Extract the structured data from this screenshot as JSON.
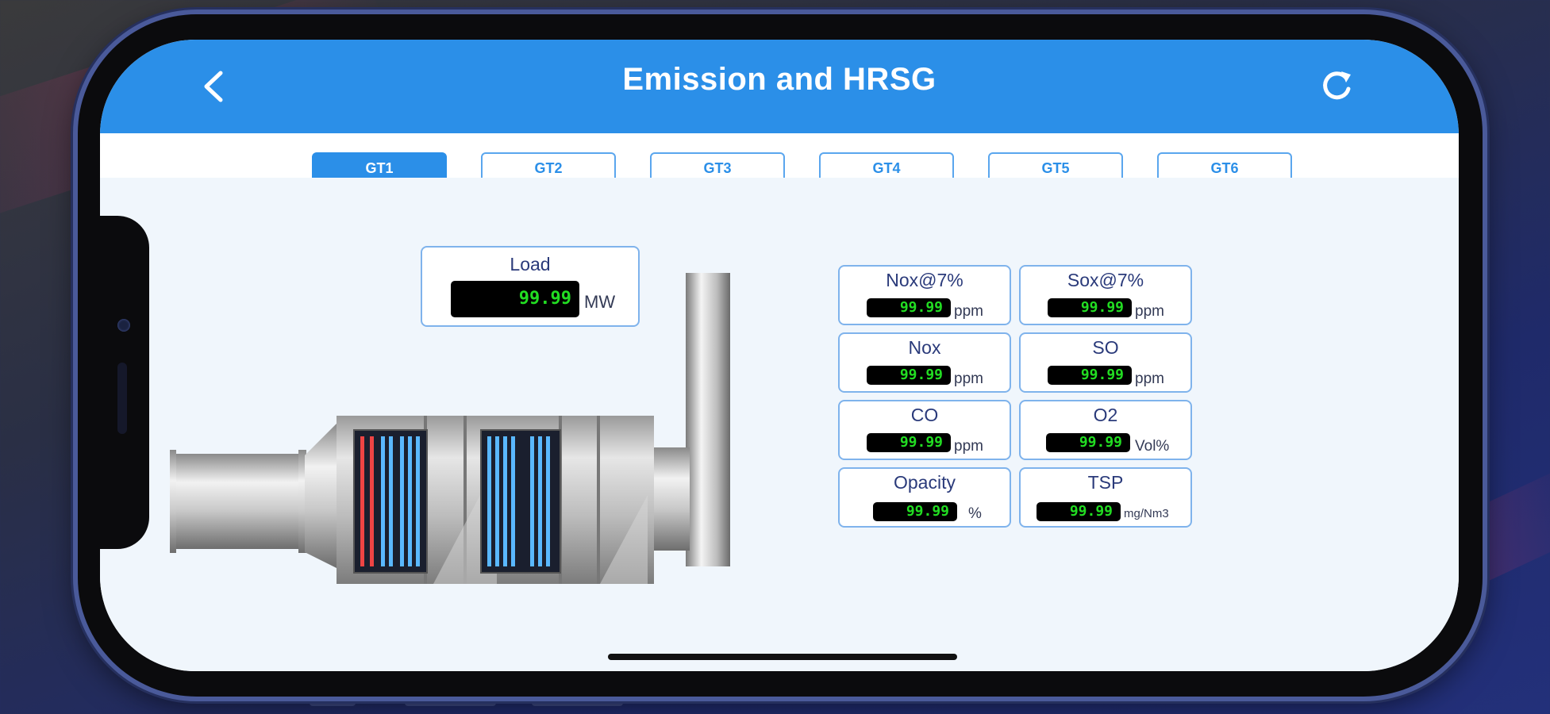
{
  "header": {
    "title": "Emission and HRSG",
    "back_icon": "chevron-left-icon",
    "refresh_icon": "refresh-icon",
    "color": "#2b8fe8"
  },
  "tabs": [
    {
      "label": "GT1",
      "active": true
    },
    {
      "label": "GT2",
      "active": false
    },
    {
      "label": "GT3",
      "active": false
    },
    {
      "label": "GT4",
      "active": false
    },
    {
      "label": "GT5",
      "active": false
    },
    {
      "label": "GT6",
      "active": false
    }
  ],
  "load": {
    "label": "Load",
    "value": "99.99",
    "unit": "MW"
  },
  "metrics": [
    {
      "label": "Nox@7%",
      "value": "99.99",
      "unit": "ppm"
    },
    {
      "label": "Sox@7%",
      "value": "99.99",
      "unit": "ppm"
    },
    {
      "label": "Nox",
      "value": "99.99",
      "unit": "ppm"
    },
    {
      "label": "SO",
      "value": "99.99",
      "unit": "ppm"
    },
    {
      "label": "CO",
      "value": "99.99",
      "unit": "ppm"
    },
    {
      "label": "O2",
      "value": "99.99",
      "unit": "Vol%"
    },
    {
      "label": "Opacity",
      "value": "99.99",
      "unit": "%"
    },
    {
      "label": "TSP",
      "value": "99.99",
      "unit": "mg/Nm3"
    }
  ],
  "colors": {
    "lcd_text": "#22dd22",
    "lcd_bg": "#000000",
    "border": "#7fb3ec"
  }
}
